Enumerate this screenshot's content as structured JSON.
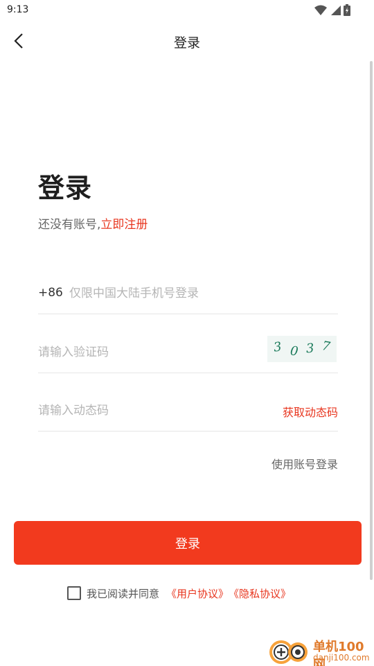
{
  "status_bar": {
    "time": "9:13",
    "icons": [
      "wifi-icon",
      "signal-icon",
      "battery-icon"
    ]
  },
  "app_bar": {
    "back_icon": "chevron-left-icon",
    "title": "登录"
  },
  "hero": {
    "title": "登录",
    "subtitle_prefix": "还没有账号,",
    "register_link": "立即注册"
  },
  "form": {
    "phone": {
      "prefix": "+86",
      "placeholder": "仅限中国大陆手机号登录",
      "value": ""
    },
    "captcha": {
      "placeholder": "请输入验证码",
      "value": "",
      "image_text": [
        "3",
        "0",
        "3",
        "7"
      ]
    },
    "dynamic_code": {
      "placeholder": "请输入动态码",
      "value": "",
      "get_code_label": "获取动态码"
    },
    "account_login_label": "使用账号登录"
  },
  "login_button_label": "登录",
  "agreement": {
    "checked": false,
    "text": "我已阅读并同意",
    "user_agreement": "《用户协议》",
    "privacy_agreement": "《隐私协议》"
  },
  "watermark": {
    "name": "单机100网",
    "domain": "danji100.com"
  },
  "colors": {
    "accent": "#f23a1e",
    "link": "#e8361f",
    "watermark": "#e07a2b"
  }
}
